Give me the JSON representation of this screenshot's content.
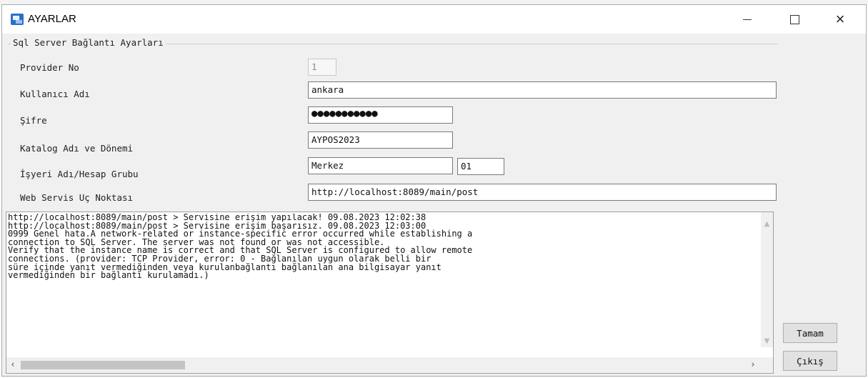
{
  "window": {
    "title": "AYARLAR",
    "controls": {
      "minimize": "minimize",
      "maximize": "maximize",
      "close": "×"
    }
  },
  "group": {
    "title": "Sql Server Bağlantı Ayarları"
  },
  "form": {
    "provider_no": {
      "label": "Provider No",
      "value": "1"
    },
    "username": {
      "label": "Kullanıcı Adı",
      "value": "ankara"
    },
    "password": {
      "label": "Şifre",
      "value": "●●●●●●●●●●●"
    },
    "catalog": {
      "label": "Katalog Adı ve Dönemi",
      "value": "AYPOS2023"
    },
    "workplace": {
      "label": "İşyeri Adı/Hesap Grubu",
      "value": "Merkez",
      "group_value": "01"
    },
    "web_service": {
      "label": "Web Servis Uç Noktası",
      "value": "http://localhost:8089/main/post"
    }
  },
  "log": {
    "text": "http://localhost:8089/main/post > Servisine erişim yapılacak! 09.08.2023 12:02:38\nhttp://localhost:8089/main/post > Servisine erişim başarısız. 09.08.2023 12:03:00\n0999 Genel hata.A network-related or instance-specific error occurred while establishing a\nconnection to SQL Server. The server was not found or was not accessible.\nVerify that the instance name is correct and that SQL Server is configured to allow remote\nconnections. (provider: TCP Provider, error: 0 - Bağlanılan uygun olarak belli bir\nsüre içinde yanıt vermediğinden veya kurulanbağlantı bağlanılan ana bilgisayar yanıt\nvermediğinden bir bağlantı kurulamadı.)"
  },
  "buttons": {
    "ok": "Tamam",
    "exit": "Çıkış"
  },
  "icons": {
    "app": "window-app-icon",
    "scroll_up": "▲",
    "scroll_down": "▼",
    "scroll_left": "‹",
    "scroll_right": "›"
  }
}
